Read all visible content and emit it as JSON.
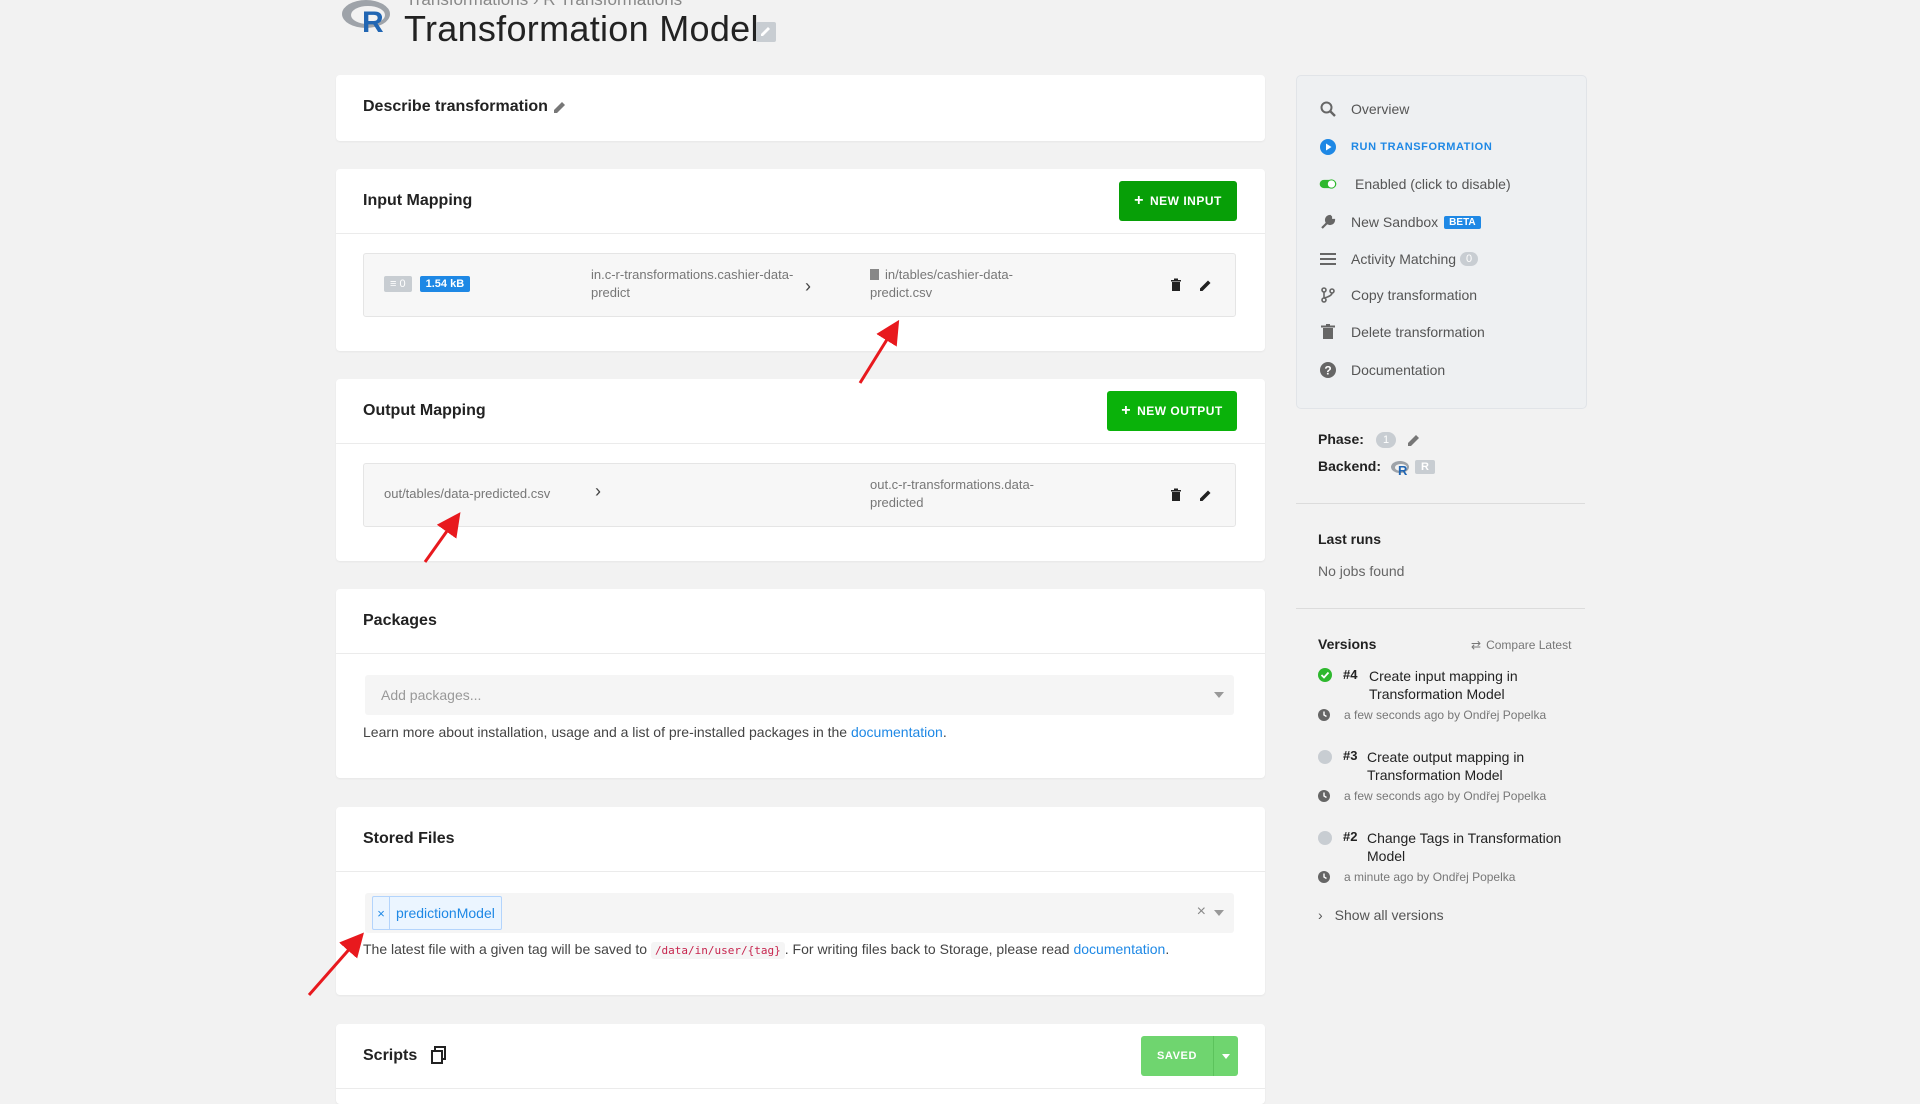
{
  "header": {
    "breadcrumb": "Transformations › R Transformations",
    "title": "Transformation Model",
    "logo_letter": "R"
  },
  "describe": {
    "label": "Describe transformation"
  },
  "input_mapping": {
    "title": "Input Mapping",
    "button": "NEW INPUT",
    "row": {
      "rows_count": "0",
      "size": "1.54 kB",
      "source_line1": "in.c-r-transformations.cashier-data-",
      "source_line2": "predict",
      "dest_line1": "in/tables/cashier-data-",
      "dest_line2": "predict.csv"
    }
  },
  "output_mapping": {
    "title": "Output Mapping",
    "button": "NEW OUTPUT",
    "row": {
      "source": "out/tables/data-predicted.csv",
      "dest_line1": "out.c-r-transformations.data-",
      "dest_line2": "predicted"
    }
  },
  "packages": {
    "title": "Packages",
    "placeholder": "Add packages...",
    "help_text": "Learn more about installation, usage and a list of pre-installed packages in the",
    "help_link": "documentation",
    "help_end": "."
  },
  "stored_files": {
    "title": "Stored Files",
    "tag": "predictionModel",
    "tag_remove": "×",
    "clear": "×",
    "help_text": "The latest file with a given tag will be saved to",
    "help_code": "/data/in/user/{tag}",
    "help_text2": ". For writing files back to Storage, please read",
    "help_link": "documentation",
    "help_end": "."
  },
  "scripts": {
    "title": "Scripts",
    "button": "SAVED"
  },
  "sidebar": {
    "items": [
      {
        "label": "Overview"
      },
      {
        "label": "RUN TRANSFORMATION"
      },
      {
        "label": "Enabled (click to disable)"
      },
      {
        "label": "New Sandbox",
        "badge": "BETA"
      },
      {
        "label": "Activity Matching",
        "badge": "0"
      },
      {
        "label": "Copy transformation"
      },
      {
        "label": "Delete transformation"
      },
      {
        "label": "Documentation"
      }
    ],
    "phase_label": "Phase:",
    "phase_value": "1",
    "backend_label": "Backend:",
    "backend_value": "R"
  },
  "last_runs": {
    "title": "Last runs",
    "empty": "No jobs found"
  },
  "versions": {
    "title": "Versions",
    "compare": "Compare Latest",
    "items": [
      {
        "num": "#4",
        "line1": "Create input mapping in",
        "line2": "Transformation Model",
        "meta": "a few seconds ago by Ondřej Popelka"
      },
      {
        "num": "#3",
        "line1": "Create output mapping in",
        "line2": "Transformation Model",
        "meta": "a few seconds ago by Ondřej Popelka"
      },
      {
        "num": "#2",
        "line1": "Change Tags in Transformation",
        "line2": "Model",
        "meta": "a minute ago by Ondřej Popelka"
      }
    ],
    "show_all": "Show all versions"
  },
  "colors": {
    "green": "#079f07",
    "blue": "#1e88e5",
    "annotation": "#e8191e"
  }
}
